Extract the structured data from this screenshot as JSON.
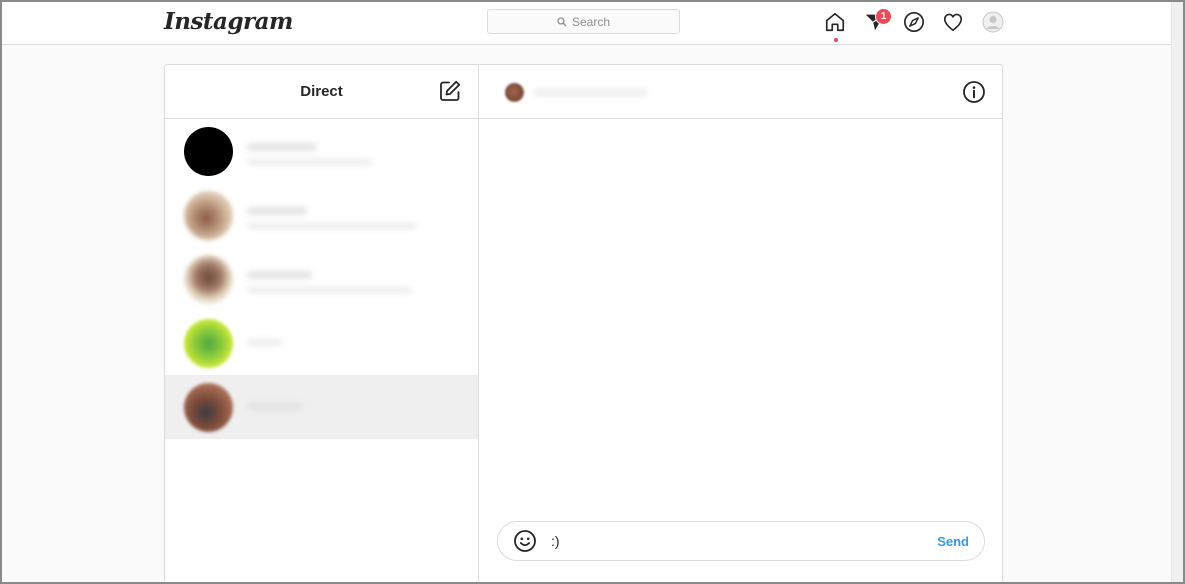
{
  "app": {
    "logo_text": "Instagram"
  },
  "search": {
    "placeholder": "Search"
  },
  "nav": {
    "icons": [
      "home-icon",
      "direct-icon",
      "explore-icon",
      "activity-icon",
      "profile-icon"
    ],
    "direct_badge": "1",
    "badge_color": "#ed4956"
  },
  "inbox": {
    "title": "Direct",
    "compose_icon": "compose-icon",
    "threads": [
      {
        "avatar_colors": [
          "#000000",
          "#000000"
        ]
      },
      {
        "avatar_colors": [
          "#d9c2a8",
          "#8c5b48"
        ]
      },
      {
        "avatar_colors": [
          "#f0ead8",
          "#6e4a3c"
        ]
      },
      {
        "avatar_colors": [
          "#d6ee35",
          "#4ea843"
        ]
      },
      {
        "avatar_colors": [
          "#a36a52",
          "#3d3a44"
        ],
        "active": true
      }
    ]
  },
  "conversation": {
    "info_icon": "info-icon",
    "composer": {
      "emoji_icon": "emoji-icon",
      "value": ":)",
      "send_label": "Send",
      "send_color": "#3897f0"
    }
  }
}
